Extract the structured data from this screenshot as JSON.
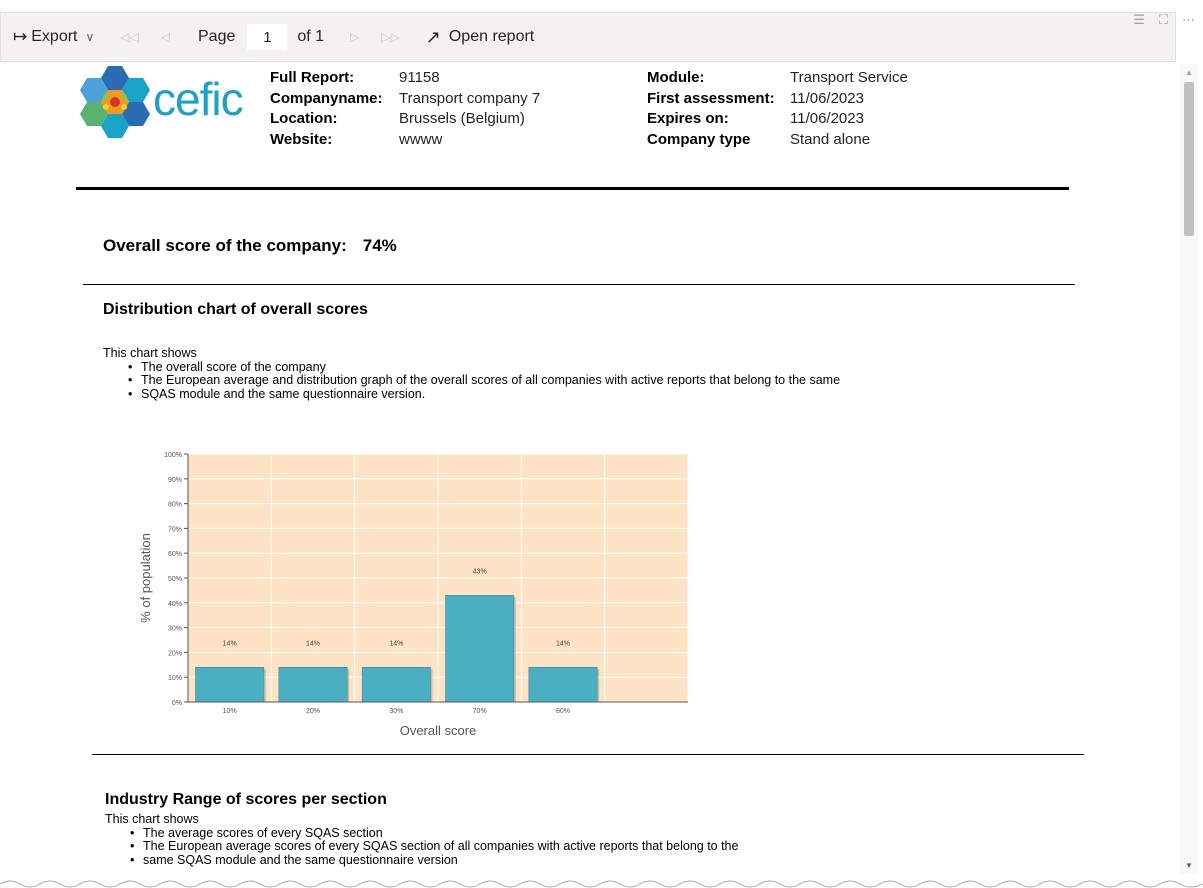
{
  "toolbar": {
    "export_label": "Export",
    "page_label": "Page",
    "page_value": "1",
    "of_label": "of 1",
    "open_report_label": "Open report"
  },
  "header": {
    "logo_text": "cefic",
    "left": [
      {
        "label": "Full Report:",
        "value": "91158"
      },
      {
        "label": "Companyname:",
        "value": "Transport company 7"
      },
      {
        "label": "Location:",
        "value": "Brussels (Belgium)"
      },
      {
        "label": "Website:",
        "value": "wwww"
      }
    ],
    "right": [
      {
        "label": "Module:",
        "value": "Transport Service"
      },
      {
        "label": "First assessment:",
        "value": "11/06/2023"
      },
      {
        "label": "Expires on:",
        "value": "11/06/2023"
      },
      {
        "label": "Company type",
        "value": "Stand alone"
      }
    ]
  },
  "overall": {
    "label": "Overall score of the company:",
    "value": "74%"
  },
  "distribution": {
    "title": "Distribution chart of overall scores",
    "intro": "This chart shows",
    "bullets": [
      "The overall score of the company",
      "The European average and distribution graph of the overall scores of all companies with active reports that belong to the same",
      "SQAS module and the same questionnaire version."
    ]
  },
  "industry": {
    "title": "Industry Range of scores per section",
    "intro": "This chart shows",
    "bullets": [
      "The average scores of every SQAS section",
      "The European average scores of every SQAS section of all companies with active reports that belong to the",
      "same SQAS module and the same questionnaire version"
    ]
  },
  "colors": {
    "bar": "#4bafc4",
    "plot_bg": "#fde3c4",
    "accent": "#1aa3c9"
  },
  "chart_data": {
    "type": "bar",
    "categories": [
      "10%",
      "20%",
      "30%",
      "70%",
      "80%"
    ],
    "values": [
      14,
      14,
      14,
      43,
      14
    ],
    "data_labels": [
      "14%",
      "14%",
      "14%",
      "43%",
      "14%"
    ],
    "xlabel": "Overall score",
    "ylabel": "% of population",
    "ylim": [
      0,
      100
    ],
    "yticks": [
      "0%",
      "10%",
      "20%",
      "30%",
      "40%",
      "50%",
      "60%",
      "70%",
      "80%",
      "90%",
      "100%"
    ],
    "grid": true
  }
}
